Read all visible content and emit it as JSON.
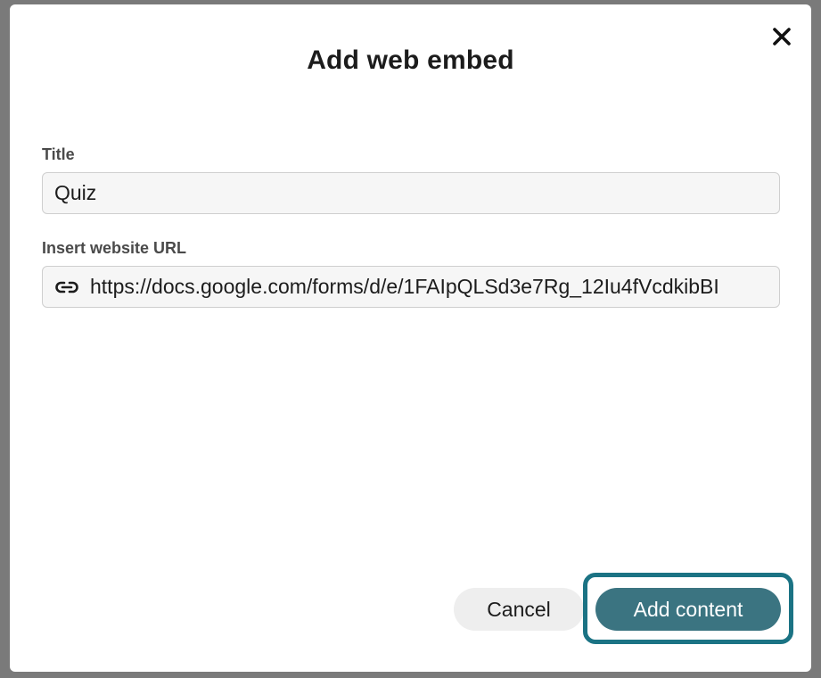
{
  "dialog": {
    "title": "Add web embed",
    "close_icon": "close-icon"
  },
  "fields": {
    "title_label": "Title",
    "title_value": "Quiz",
    "url_label": "Insert website URL",
    "url_icon": "link-icon",
    "url_value": "https://docs.google.com/forms/d/e/1FAIpQLSd3e7Rg_12Iu4fVcdkibBI"
  },
  "actions": {
    "cancel_label": "Cancel",
    "add_label": "Add content"
  },
  "colors": {
    "primary_button": "#3b7481",
    "focus_ring": "#1b7384"
  }
}
